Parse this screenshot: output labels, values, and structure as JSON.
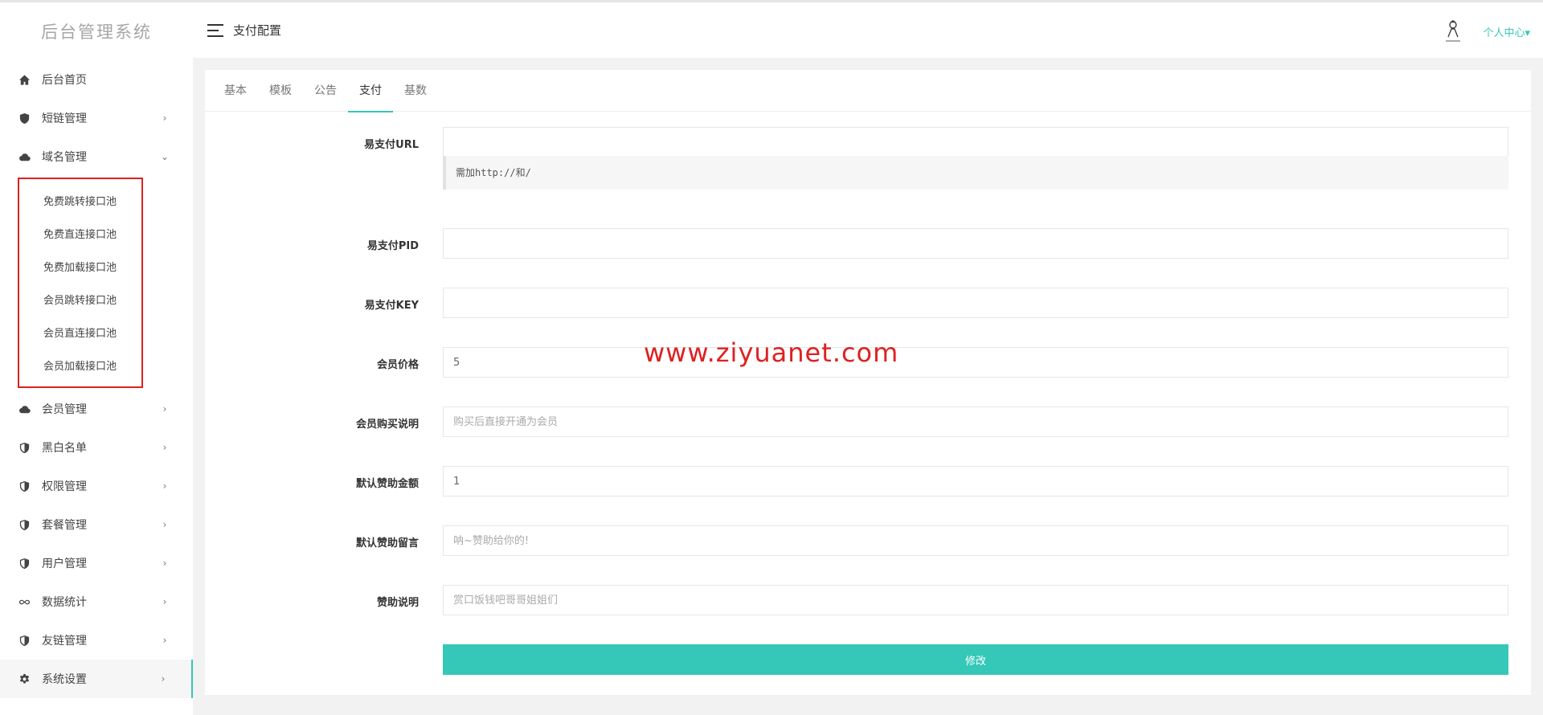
{
  "sidebar": {
    "logo": "后台管理系统",
    "items": [
      {
        "label": "后台首页",
        "icon": "home-icon",
        "chev": ""
      },
      {
        "label": "短链管理",
        "icon": "shield-icon",
        "chev": "›"
      },
      {
        "label": "域名管理",
        "icon": "cloud-icon",
        "chev": "⌄"
      },
      {
        "label": "会员管理",
        "icon": "cloud-icon",
        "chev": "›"
      },
      {
        "label": "黑白名单",
        "icon": "shield-half-icon",
        "chev": "›"
      },
      {
        "label": "权限管理",
        "icon": "shield-half-icon",
        "chev": "›"
      },
      {
        "label": "套餐管理",
        "icon": "shield-half-icon",
        "chev": "›"
      },
      {
        "label": "用户管理",
        "icon": "shield-half-icon",
        "chev": "›"
      },
      {
        "label": "数据统计",
        "icon": "infinity-icon",
        "chev": "›"
      },
      {
        "label": "友链管理",
        "icon": "shield-half-icon",
        "chev": "›"
      },
      {
        "label": "系统设置",
        "icon": "gear-icon",
        "chev": "›"
      }
    ],
    "domain_submenu": [
      "免费跳转接口池",
      "免费直连接口池",
      "免费加载接口池",
      "会员跳转接口池",
      "会员直连接口池",
      "会员加载接口池"
    ]
  },
  "header": {
    "title": "支付配置",
    "user_menu": "个人中心▾"
  },
  "tabs": [
    "基本",
    "模板",
    "公告",
    "支付",
    "基数"
  ],
  "active_tab": "支付",
  "form": {
    "epay_url": {
      "label": "易支付URL",
      "value": "",
      "hint": "需加http://和/"
    },
    "epay_pid": {
      "label": "易支付PID",
      "value": ""
    },
    "epay_key": {
      "label": "易支付KEY",
      "value": ""
    },
    "member_price": {
      "label": "会员价格",
      "value": "5"
    },
    "member_desc": {
      "label": "会员购买说明",
      "placeholder": "购买后直接开通为会员"
    },
    "donate_amount": {
      "label": "默认赞助金额",
      "value": "1"
    },
    "donate_msg": {
      "label": "默认赞助留言",
      "placeholder": "呐~赞助给你的!"
    },
    "donate_desc": {
      "label": "赞助说明",
      "placeholder": "赏口饭钱吧哥哥姐姐们"
    },
    "submit_label": "修改"
  },
  "watermark": "www.ziyuanet.com",
  "colors": {
    "accent": "#35c7b7",
    "highlight": "#e02020"
  }
}
